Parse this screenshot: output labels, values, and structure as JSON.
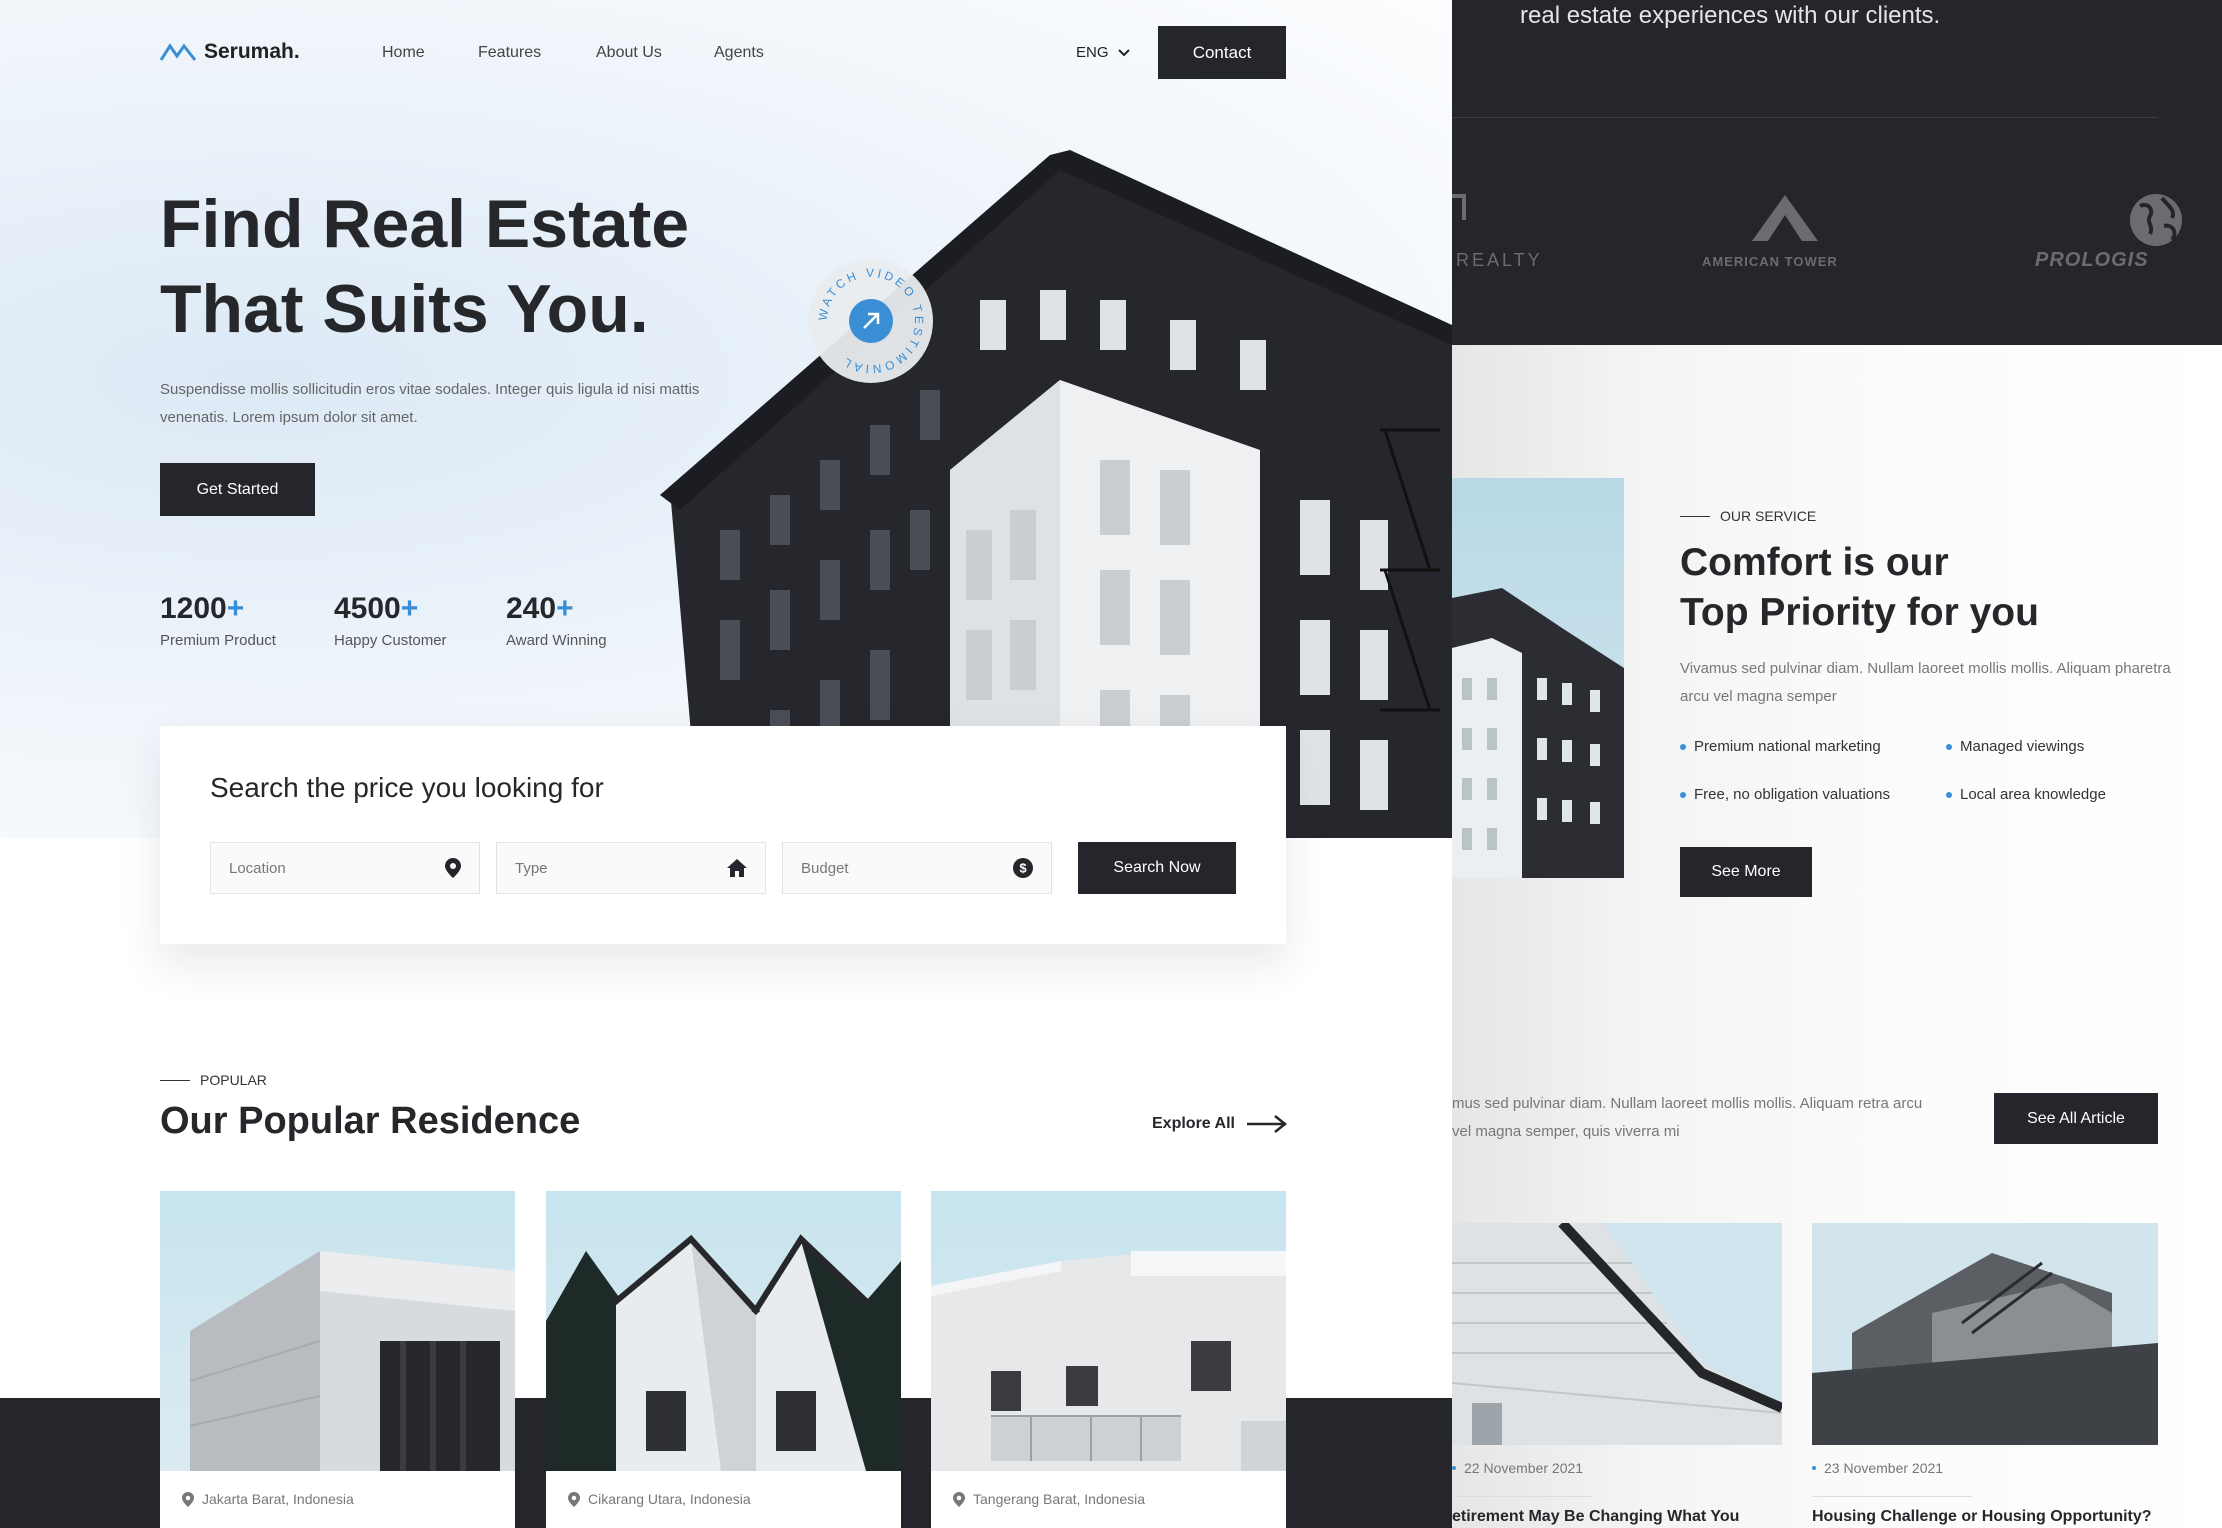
{
  "nav": {
    "brand": "Serumah.",
    "links": [
      "Home",
      "Features",
      "About Us",
      "Agents"
    ],
    "language": "ENG",
    "contact_label": "Contact"
  },
  "hero": {
    "title_line1": "Find Real Estate",
    "title_line2": "That Suits You.",
    "description": "Suspendisse mollis sollicitudin eros vitae sodales. Integer quis ligula id nisi mattis venenatis. Lorem ipsum dolor sit amet.",
    "cta_label": "Get Started",
    "badge_text": "WATCH VIDEO TESTIMONIAL",
    "stats": [
      {
        "number": "1200",
        "plus": "+",
        "label": "Premium Product"
      },
      {
        "number": "4500",
        "plus": "+",
        "label": "Happy Customer"
      },
      {
        "number": "240",
        "plus": "+",
        "label": "Award Winning"
      }
    ]
  },
  "search": {
    "title": "Search the price you looking for",
    "location_placeholder": "Location",
    "type_placeholder": "Type",
    "budget_placeholder": "Budget",
    "button_label": "Search Now"
  },
  "popular": {
    "eyebrow": "POPULAR",
    "title": "Our Popular Residence",
    "explore_label": "Explore All",
    "cards": [
      {
        "location": "Jakarta Barat, Indonesia"
      },
      {
        "location": "Cikarang Utara, Indonesia"
      },
      {
        "location": "Tangerang Barat, Indonesia"
      }
    ]
  },
  "right_panel": {
    "quote_tail": "real estate experiences with our clients.",
    "partner_logos": [
      "REALTY",
      "AMERICAN TOWER",
      "PROLOGIS"
    ],
    "service": {
      "eyebrow": "OUR SERVICE",
      "title_line1": "Comfort is our",
      "title_line2": "Top Priority for you",
      "description": "Vivamus sed pulvinar diam. Nullam laoreet mollis mollis. Aliquam pharetra arcu vel magna semper",
      "features": [
        "Premium national marketing",
        "Managed viewings",
        "Free, no obligation valuations",
        "Local area knowledge"
      ],
      "see_more_label": "See More"
    },
    "articles": {
      "description": "mus sed pulvinar diam. Nullam laoreet mollis mollis. Aliquam retra arcu vel magna semper, quis viverra mi",
      "see_all_label": "See All Article",
      "items": [
        {
          "date": "22 November 2021",
          "title": "etirement May Be Changing What You"
        },
        {
          "date": "23 November 2021",
          "title": "Housing Challenge or Housing Opportunity?"
        }
      ]
    }
  },
  "colors": {
    "dark": "#25262b",
    "accent": "#3a8ed4"
  }
}
